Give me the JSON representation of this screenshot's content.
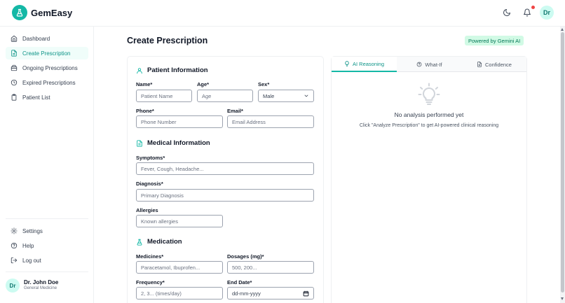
{
  "app": {
    "brand": "GemEasy"
  },
  "header": {
    "avatar_initials": "Dr"
  },
  "sidebar": {
    "items": [
      {
        "label": "Dashboard",
        "icon": "home-icon"
      },
      {
        "label": "Create Prescription",
        "icon": "file-plus-icon",
        "active": true
      },
      {
        "label": "Ongoing Prescriptions",
        "icon": "package-icon"
      },
      {
        "label": "Expired Prescriptions",
        "icon": "clock-icon"
      },
      {
        "label": "Patient List",
        "icon": "clipboard-icon"
      }
    ],
    "bottom_items": [
      {
        "label": "Settings",
        "icon": "gear-icon"
      },
      {
        "label": "Help",
        "icon": "help-circle-icon"
      },
      {
        "label": "Log out",
        "icon": "logout-icon"
      }
    ],
    "user": {
      "initials": "Dr",
      "name": "Dr. John Doe",
      "role": "General Medicine"
    }
  },
  "main": {
    "title": "Create Prescription",
    "powered_badge": "Powered by Gemini AI"
  },
  "form": {
    "patient": {
      "title": "Patient Information",
      "name_label": "Name*",
      "name_placeholder": "Patient Name",
      "age_label": "Age*",
      "age_placeholder": "Age",
      "sex_label": "Sex*",
      "sex_value": "Male",
      "phone_label": "Phone*",
      "phone_placeholder": "Phone Number",
      "email_label": "Email*",
      "email_placeholder": "Email Address"
    },
    "medical": {
      "title": "Medical Information",
      "symptoms_label": "Symptoms*",
      "symptoms_placeholder": "Fever, Cough, Headache...",
      "diagnosis_label": "Diagnosis*",
      "diagnosis_placeholder": "Primary Diagnosis",
      "allergies_label": "Allergies",
      "allergies_placeholder": "Known allergies"
    },
    "medication": {
      "title": "Medication",
      "medicines_label": "Medicines*",
      "medicines_placeholder": "Paracetamol, Ibuprofen...",
      "dosages_label": "Dosages (mg)*",
      "dosages_placeholder": "500, 200...",
      "frequency_label": "Frequency*",
      "frequency_placeholder": "2, 3... (times/day)",
      "end_date_label": "End Date*",
      "end_date_value": "dd-mm-yyyy"
    }
  },
  "ai_panel": {
    "tabs": [
      {
        "label": "AI Reasoning",
        "active": true
      },
      {
        "label": "What-If"
      },
      {
        "label": "Confidence"
      }
    ],
    "empty_title": "No analysis performed yet",
    "empty_subtitle": "Click \"Analyze Prescription\" to get AI-powered clinical reasoning"
  },
  "colors": {
    "accent": "#14b8a6",
    "accent_dark": "#0d9488",
    "badge_bg": "#d1fae5",
    "notification": "#ef4444"
  }
}
